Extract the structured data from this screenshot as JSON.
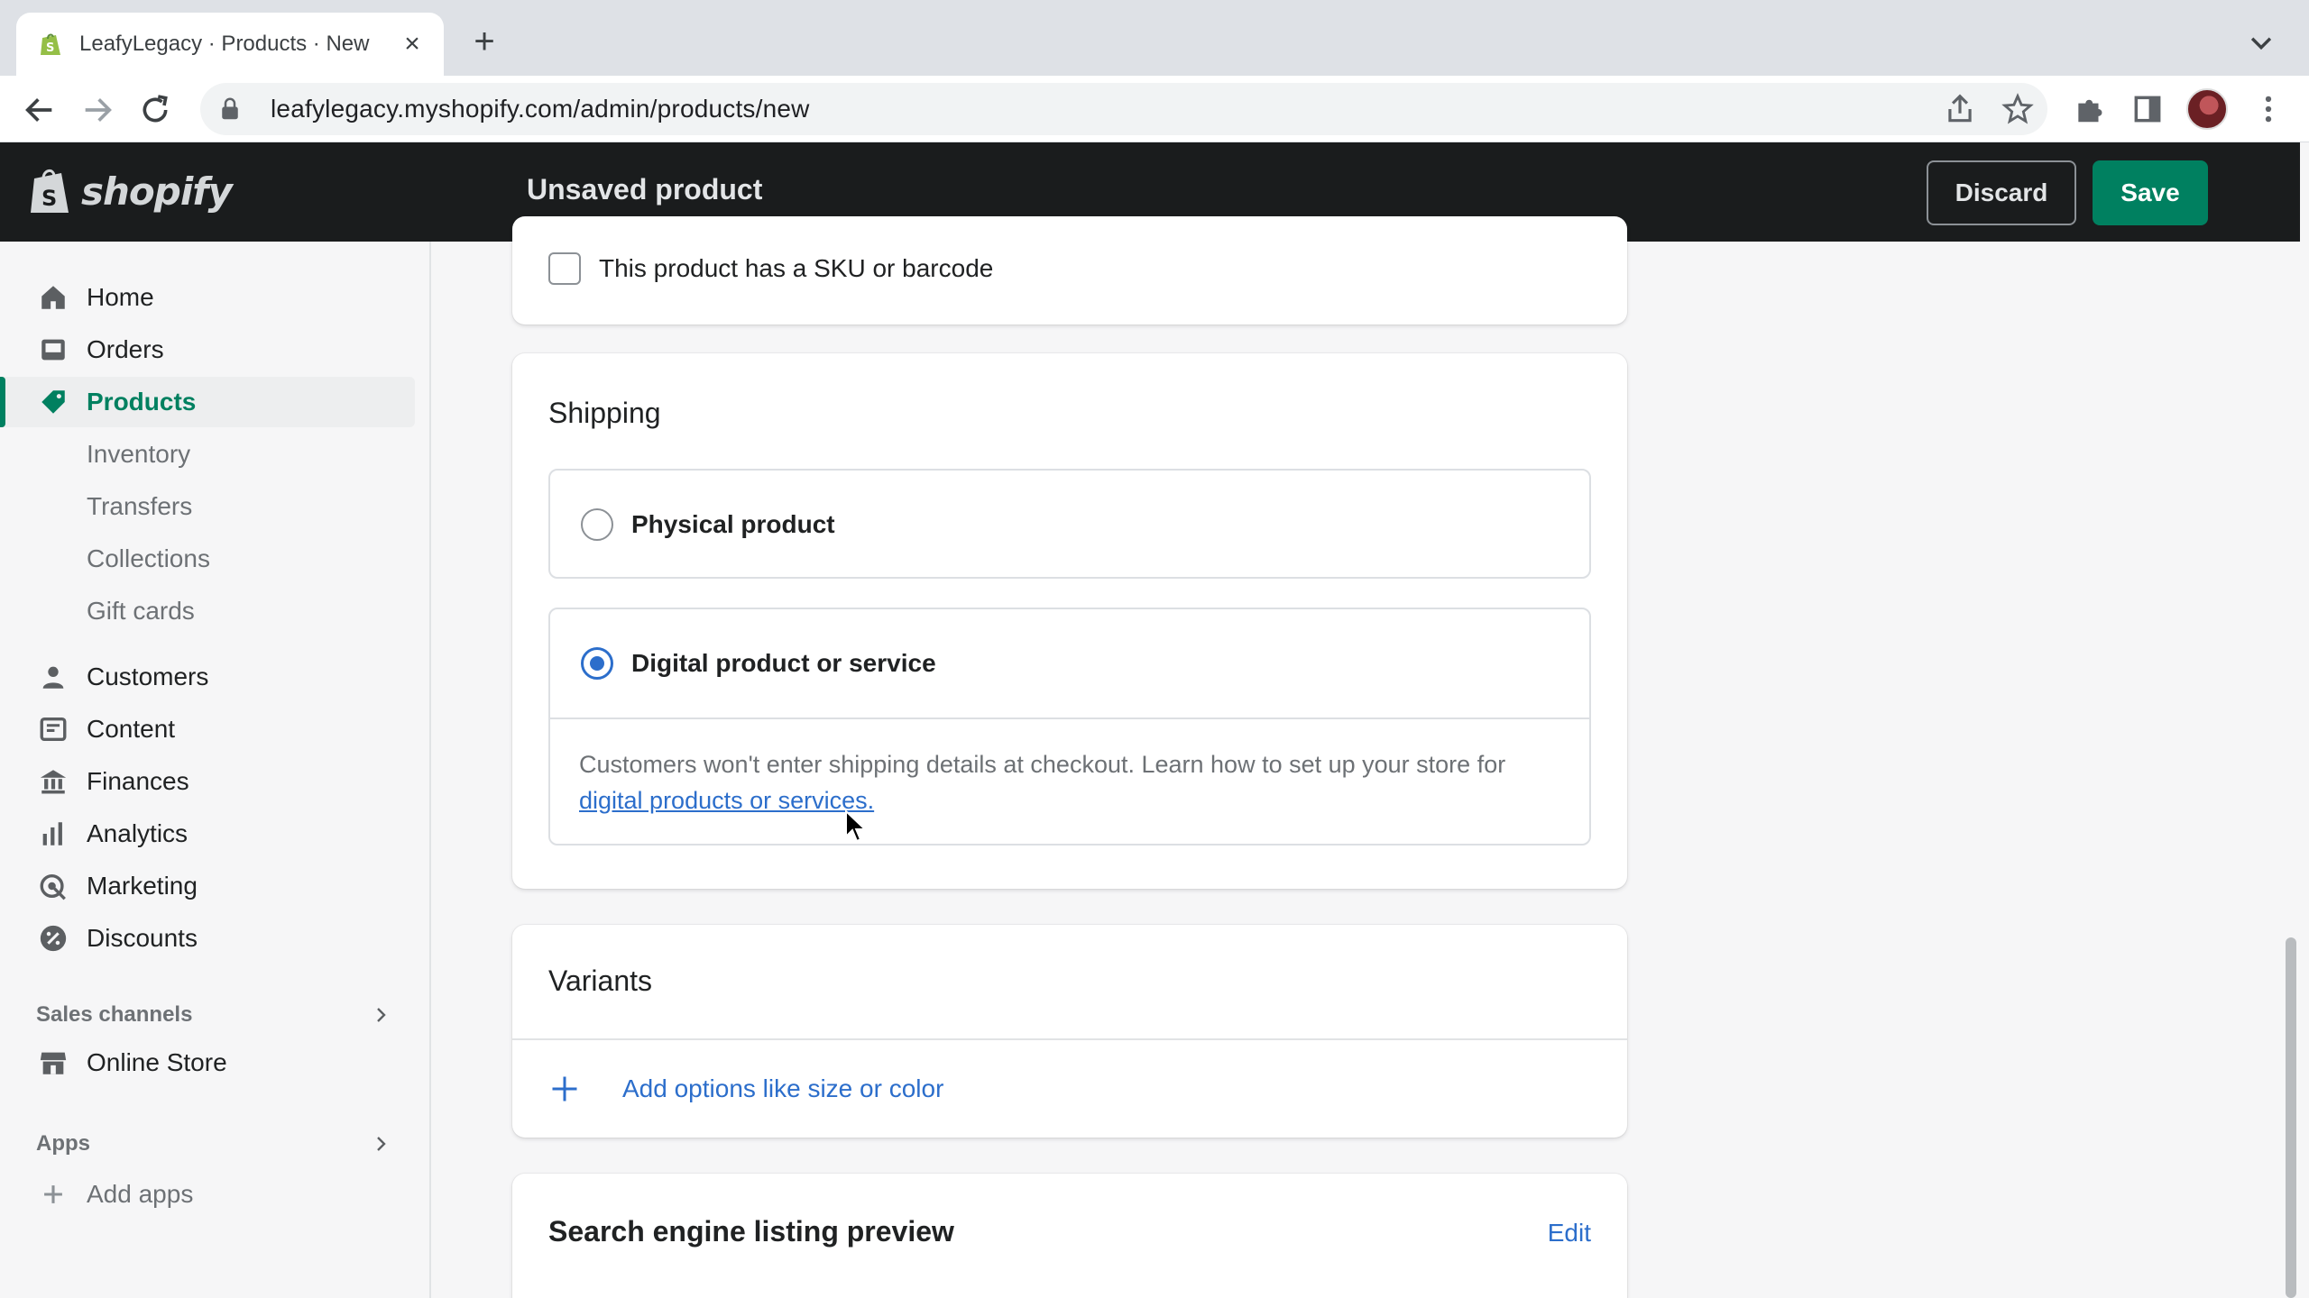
{
  "browser": {
    "tab_title": "LeafyLegacy · Products · New",
    "url": "leafylegacy.myshopify.com/admin/products/new"
  },
  "topbar": {
    "logo_text": "shopify",
    "page_title": "Unsaved product",
    "discard_label": "Discard",
    "save_label": "Save"
  },
  "sidebar": {
    "items": [
      {
        "label": "Home",
        "icon": "home-icon"
      },
      {
        "label": "Orders",
        "icon": "orders-icon"
      },
      {
        "label": "Products",
        "icon": "tag-icon",
        "active": true
      },
      {
        "label": "Inventory"
      },
      {
        "label": "Transfers"
      },
      {
        "label": "Collections"
      },
      {
        "label": "Gift cards"
      },
      {
        "label": "Customers",
        "icon": "person-icon"
      },
      {
        "label": "Content",
        "icon": "content-icon"
      },
      {
        "label": "Finances",
        "icon": "bank-icon"
      },
      {
        "label": "Analytics",
        "icon": "bar-chart-icon"
      },
      {
        "label": "Marketing",
        "icon": "marketing-icon"
      },
      {
        "label": "Discounts",
        "icon": "discount-icon"
      }
    ],
    "sales_channels_label": "Sales channels",
    "online_store_label": "Online Store",
    "apps_label": "Apps",
    "add_apps_label": "Add apps"
  },
  "main": {
    "sku_checkbox_label": "This product has a SKU or barcode",
    "shipping": {
      "title": "Shipping",
      "physical_label": "Physical product",
      "digital_label": "Digital product or service",
      "selected": "digital",
      "help_text": "Customers won't enter shipping details at checkout. Learn how to set up your store for ",
      "help_link": "digital products or services."
    },
    "variants": {
      "title": "Variants",
      "add_options_label": "Add options like size or color"
    },
    "seo": {
      "title": "Search engine listing preview",
      "edit_label": "Edit"
    }
  },
  "colors": {
    "accent_green": "#008060",
    "link_blue": "#2c6ecb",
    "topbar_bg": "#1a1c1d"
  }
}
